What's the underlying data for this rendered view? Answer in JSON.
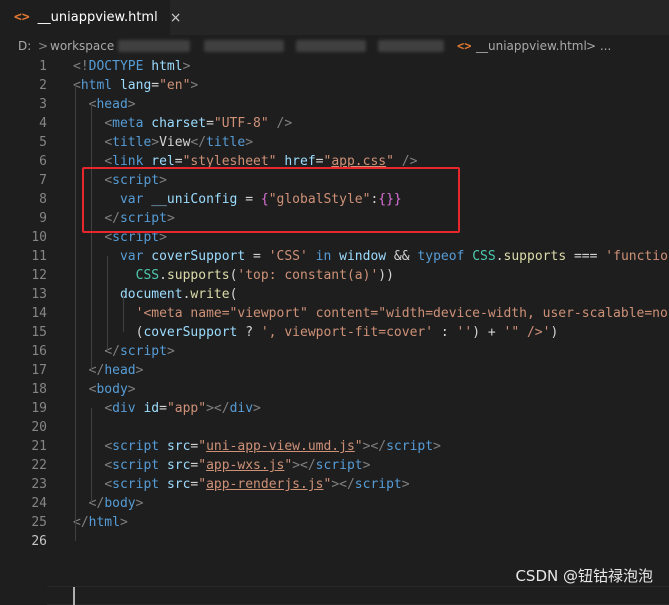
{
  "tab": {
    "icon": "<>",
    "title": "__uniappview.html",
    "close": "×"
  },
  "breadcrumb": {
    "drive": "D:",
    "sep": ">",
    "folder": "workspace",
    "file_icon": "<>",
    "file": "__uniappview.html",
    "more": "> ..."
  },
  "lines": [
    {
      "n": "1",
      "segs": [
        [
          "br",
          "<!"
        ],
        [
          "tag",
          "DOCTYPE"
        ],
        [
          "text",
          " "
        ],
        [
          "attr",
          "html"
        ],
        [
          "br",
          ">"
        ]
      ]
    },
    {
      "n": "2",
      "segs": [
        [
          "br",
          "<"
        ],
        [
          "tag",
          "html"
        ],
        [
          "text",
          " "
        ],
        [
          "attr",
          "lang"
        ],
        [
          "text",
          "="
        ],
        [
          "str",
          "\"en\""
        ],
        [
          "br",
          ">"
        ]
      ]
    },
    {
      "n": "3",
      "segs": [
        [
          "text",
          "  "
        ],
        [
          "br",
          "<"
        ],
        [
          "tag",
          "head"
        ],
        [
          "br",
          ">"
        ]
      ]
    },
    {
      "n": "4",
      "segs": [
        [
          "text",
          "    "
        ],
        [
          "br",
          "<"
        ],
        [
          "tag",
          "meta"
        ],
        [
          "text",
          " "
        ],
        [
          "attr",
          "charset"
        ],
        [
          "text",
          "="
        ],
        [
          "str",
          "\"UTF-8\""
        ],
        [
          "text",
          " "
        ],
        [
          "br",
          "/>"
        ]
      ]
    },
    {
      "n": "5",
      "segs": [
        [
          "text",
          "    "
        ],
        [
          "br",
          "<"
        ],
        [
          "tag",
          "title"
        ],
        [
          "br",
          ">"
        ],
        [
          "text",
          "View"
        ],
        [
          "br",
          "</"
        ],
        [
          "tag",
          "title"
        ],
        [
          "br",
          ">"
        ]
      ]
    },
    {
      "n": "6",
      "segs": [
        [
          "text",
          "    "
        ],
        [
          "br",
          "<"
        ],
        [
          "tag",
          "link"
        ],
        [
          "text",
          " "
        ],
        [
          "attr",
          "rel"
        ],
        [
          "text",
          "="
        ],
        [
          "str",
          "\"stylesheet\""
        ],
        [
          "text",
          " "
        ],
        [
          "attr",
          "href"
        ],
        [
          "text",
          "="
        ],
        [
          "str",
          "\""
        ],
        [
          "strlink",
          "app.css"
        ],
        [
          "str",
          "\""
        ],
        [
          "text",
          " "
        ],
        [
          "br",
          "/>"
        ]
      ]
    },
    {
      "n": "7",
      "segs": [
        [
          "text",
          "    "
        ],
        [
          "br",
          "<"
        ],
        [
          "tag",
          "script"
        ],
        [
          "br",
          ">"
        ]
      ]
    },
    {
      "n": "8",
      "segs": [
        [
          "text",
          "      "
        ],
        [
          "kw",
          "var"
        ],
        [
          "text",
          " "
        ],
        [
          "var",
          "__uniConfig"
        ],
        [
          "text",
          " = "
        ],
        [
          "brace",
          "{"
        ],
        [
          "str",
          "\"globalStyle\""
        ],
        [
          "text",
          ":"
        ],
        [
          "brace",
          "{}"
        ],
        [
          "brace",
          "}"
        ]
      ]
    },
    {
      "n": "9",
      "segs": [
        [
          "text",
          "    "
        ],
        [
          "br",
          "</"
        ],
        [
          "tag",
          "script"
        ],
        [
          "br",
          ">"
        ]
      ]
    },
    {
      "n": "10",
      "segs": [
        [
          "text",
          "    "
        ],
        [
          "br",
          "<"
        ],
        [
          "tag",
          "script"
        ],
        [
          "br",
          ">"
        ]
      ]
    },
    {
      "n": "11",
      "segs": [
        [
          "text",
          "      "
        ],
        [
          "kw",
          "var"
        ],
        [
          "text",
          " "
        ],
        [
          "var",
          "coverSupport"
        ],
        [
          "text",
          " = "
        ],
        [
          "str",
          "'CSS'"
        ],
        [
          "text",
          " "
        ],
        [
          "kw",
          "in"
        ],
        [
          "text",
          " "
        ],
        [
          "var",
          "window"
        ],
        [
          "text",
          " && "
        ],
        [
          "kw",
          "typeof"
        ],
        [
          "text",
          " "
        ],
        [
          "cls",
          "CSS"
        ],
        [
          "text",
          "."
        ],
        [
          "fn",
          "supports"
        ],
        [
          "text",
          " === "
        ],
        [
          "str",
          "'function"
        ]
      ]
    },
    {
      "n": "12",
      "segs": [
        [
          "text",
          "        "
        ],
        [
          "cls",
          "CSS"
        ],
        [
          "text",
          "."
        ],
        [
          "fn",
          "supports"
        ],
        [
          "text",
          "("
        ],
        [
          "str",
          "'top: constant(a)'"
        ],
        [
          "text",
          "))"
        ]
      ]
    },
    {
      "n": "13",
      "segs": [
        [
          "text",
          "      "
        ],
        [
          "var",
          "document"
        ],
        [
          "text",
          "."
        ],
        [
          "fn",
          "write"
        ],
        [
          "text",
          "("
        ]
      ]
    },
    {
      "n": "14",
      "segs": [
        [
          "text",
          "        "
        ],
        [
          "str",
          "'<meta name=\"viewport\" content=\"width=device-width, user-scalable=no,"
        ]
      ]
    },
    {
      "n": "15",
      "segs": [
        [
          "text",
          "        ("
        ],
        [
          "var",
          "coverSupport"
        ],
        [
          "text",
          " ? "
        ],
        [
          "str",
          "', viewport-fit=cover'"
        ],
        [
          "text",
          " : "
        ],
        [
          "str",
          "''"
        ],
        [
          "text",
          ") + "
        ],
        [
          "str",
          "'\" />'"
        ],
        [
          "text",
          ")"
        ]
      ]
    },
    {
      "n": "16",
      "segs": [
        [
          "text",
          "    "
        ],
        [
          "br",
          "</"
        ],
        [
          "tag",
          "script"
        ],
        [
          "br",
          ">"
        ]
      ]
    },
    {
      "n": "17",
      "segs": [
        [
          "text",
          "  "
        ],
        [
          "br",
          "</"
        ],
        [
          "tag",
          "head"
        ],
        [
          "br",
          ">"
        ]
      ]
    },
    {
      "n": "18",
      "segs": [
        [
          "text",
          "  "
        ],
        [
          "br",
          "<"
        ],
        [
          "tag",
          "body"
        ],
        [
          "br",
          ">"
        ]
      ]
    },
    {
      "n": "19",
      "segs": [
        [
          "text",
          "    "
        ],
        [
          "br",
          "<"
        ],
        [
          "tag",
          "div"
        ],
        [
          "text",
          " "
        ],
        [
          "attr",
          "id"
        ],
        [
          "text",
          "="
        ],
        [
          "str",
          "\"app\""
        ],
        [
          "br",
          "></"
        ],
        [
          "tag",
          "div"
        ],
        [
          "br",
          ">"
        ]
      ]
    },
    {
      "n": "20",
      "segs": []
    },
    {
      "n": "21",
      "segs": [
        [
          "text",
          "    "
        ],
        [
          "br",
          "<"
        ],
        [
          "tag",
          "script"
        ],
        [
          "text",
          " "
        ],
        [
          "attr",
          "src"
        ],
        [
          "text",
          "="
        ],
        [
          "str",
          "\""
        ],
        [
          "strlink",
          "uni-app-view.umd.js"
        ],
        [
          "str",
          "\""
        ],
        [
          "br",
          "></"
        ],
        [
          "tag",
          "script"
        ],
        [
          "br",
          ">"
        ]
      ]
    },
    {
      "n": "22",
      "segs": [
        [
          "text",
          "    "
        ],
        [
          "br",
          "<"
        ],
        [
          "tag",
          "script"
        ],
        [
          "text",
          " "
        ],
        [
          "attr",
          "src"
        ],
        [
          "text",
          "="
        ],
        [
          "str",
          "\""
        ],
        [
          "strlink",
          "app-wxs.js"
        ],
        [
          "str",
          "\""
        ],
        [
          "br",
          "></"
        ],
        [
          "tag",
          "script"
        ],
        [
          "br",
          ">"
        ]
      ]
    },
    {
      "n": "23",
      "segs": [
        [
          "text",
          "    "
        ],
        [
          "br",
          "<"
        ],
        [
          "tag",
          "script"
        ],
        [
          "text",
          " "
        ],
        [
          "attr",
          "src"
        ],
        [
          "text",
          "="
        ],
        [
          "str",
          "\""
        ],
        [
          "strlink",
          "app-renderjs.js"
        ],
        [
          "str",
          "\""
        ],
        [
          "br",
          "></"
        ],
        [
          "tag",
          "script"
        ],
        [
          "br",
          ">"
        ]
      ]
    },
    {
      "n": "24",
      "segs": [
        [
          "text",
          "  "
        ],
        [
          "br",
          "</"
        ],
        [
          "tag",
          "body"
        ],
        [
          "br",
          ">"
        ]
      ]
    },
    {
      "n": "25",
      "segs": [
        [
          "br",
          "</"
        ],
        [
          "tag",
          "html"
        ],
        [
          "br",
          ">"
        ]
      ]
    },
    {
      "n": "26",
      "segs": []
    }
  ],
  "active_line": "26",
  "watermark": "CSDN @钮钴禄泡泡"
}
